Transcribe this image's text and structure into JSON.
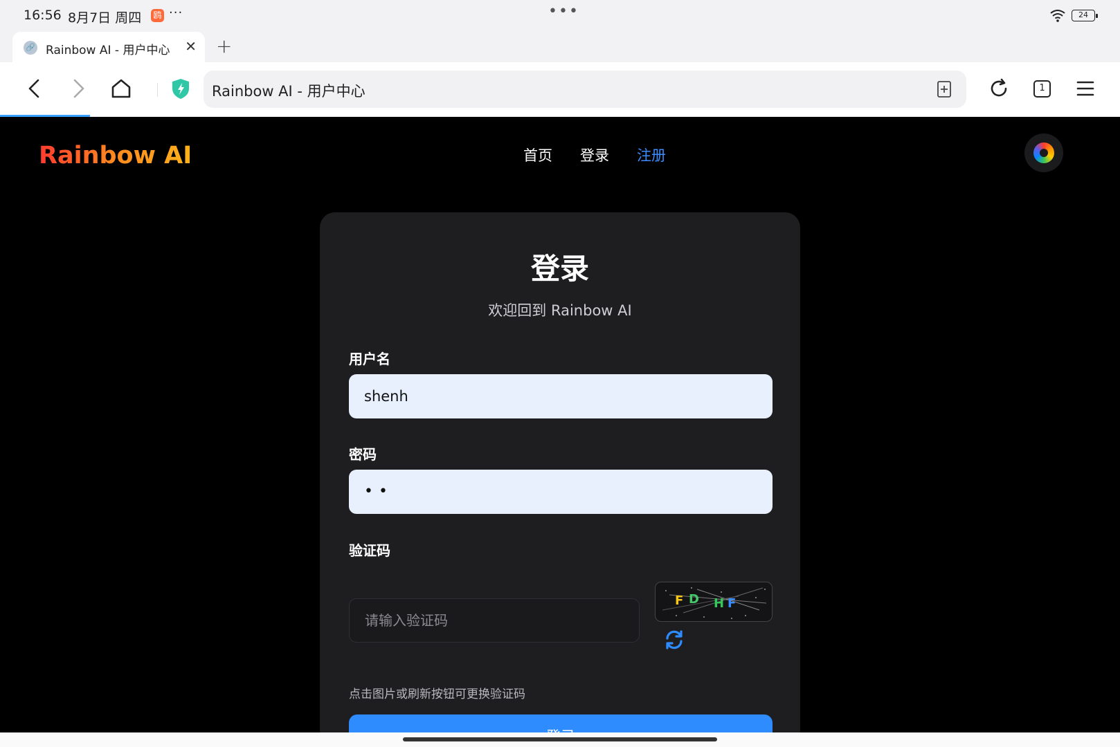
{
  "status_bar": {
    "time": "16:56",
    "date": "8月7日 周四",
    "app_badge": "鸥",
    "more": "···",
    "center": "•••",
    "battery": "24"
  },
  "tab": {
    "title": "Rainbow AI - 用户中心",
    "close": "✕",
    "new_tab": "+"
  },
  "toolbar": {
    "url": "Rainbow AI - 用户中心",
    "tab_count": "1"
  },
  "site": {
    "brand": "Rainbow AI",
    "nav": [
      {
        "label": "首页",
        "active": false
      },
      {
        "label": "登录",
        "active": false
      },
      {
        "label": "注册",
        "active": true
      }
    ]
  },
  "login": {
    "title": "登录",
    "subtitle": "欢迎回到 Rainbow AI",
    "username_label": "用户名",
    "username_value": "shenh",
    "password_label": "密码",
    "password_mask": "••",
    "captcha_label": "验证码",
    "captcha_placeholder": "请输入验证码",
    "captcha_chars": [
      "F",
      "D",
      "H",
      "F"
    ],
    "captcha_colors": [
      "#f5c518",
      "#46c76a",
      "#34c759",
      "#3a8dff"
    ],
    "hint": "点击图片或刷新按钮可更换验证码",
    "submit_label": "登录"
  },
  "colors": {
    "accent": "#2f8cff",
    "nav_active": "#3d8dff",
    "input_bg": "#e8f0fe",
    "card_bg": "#1e1e21"
  }
}
